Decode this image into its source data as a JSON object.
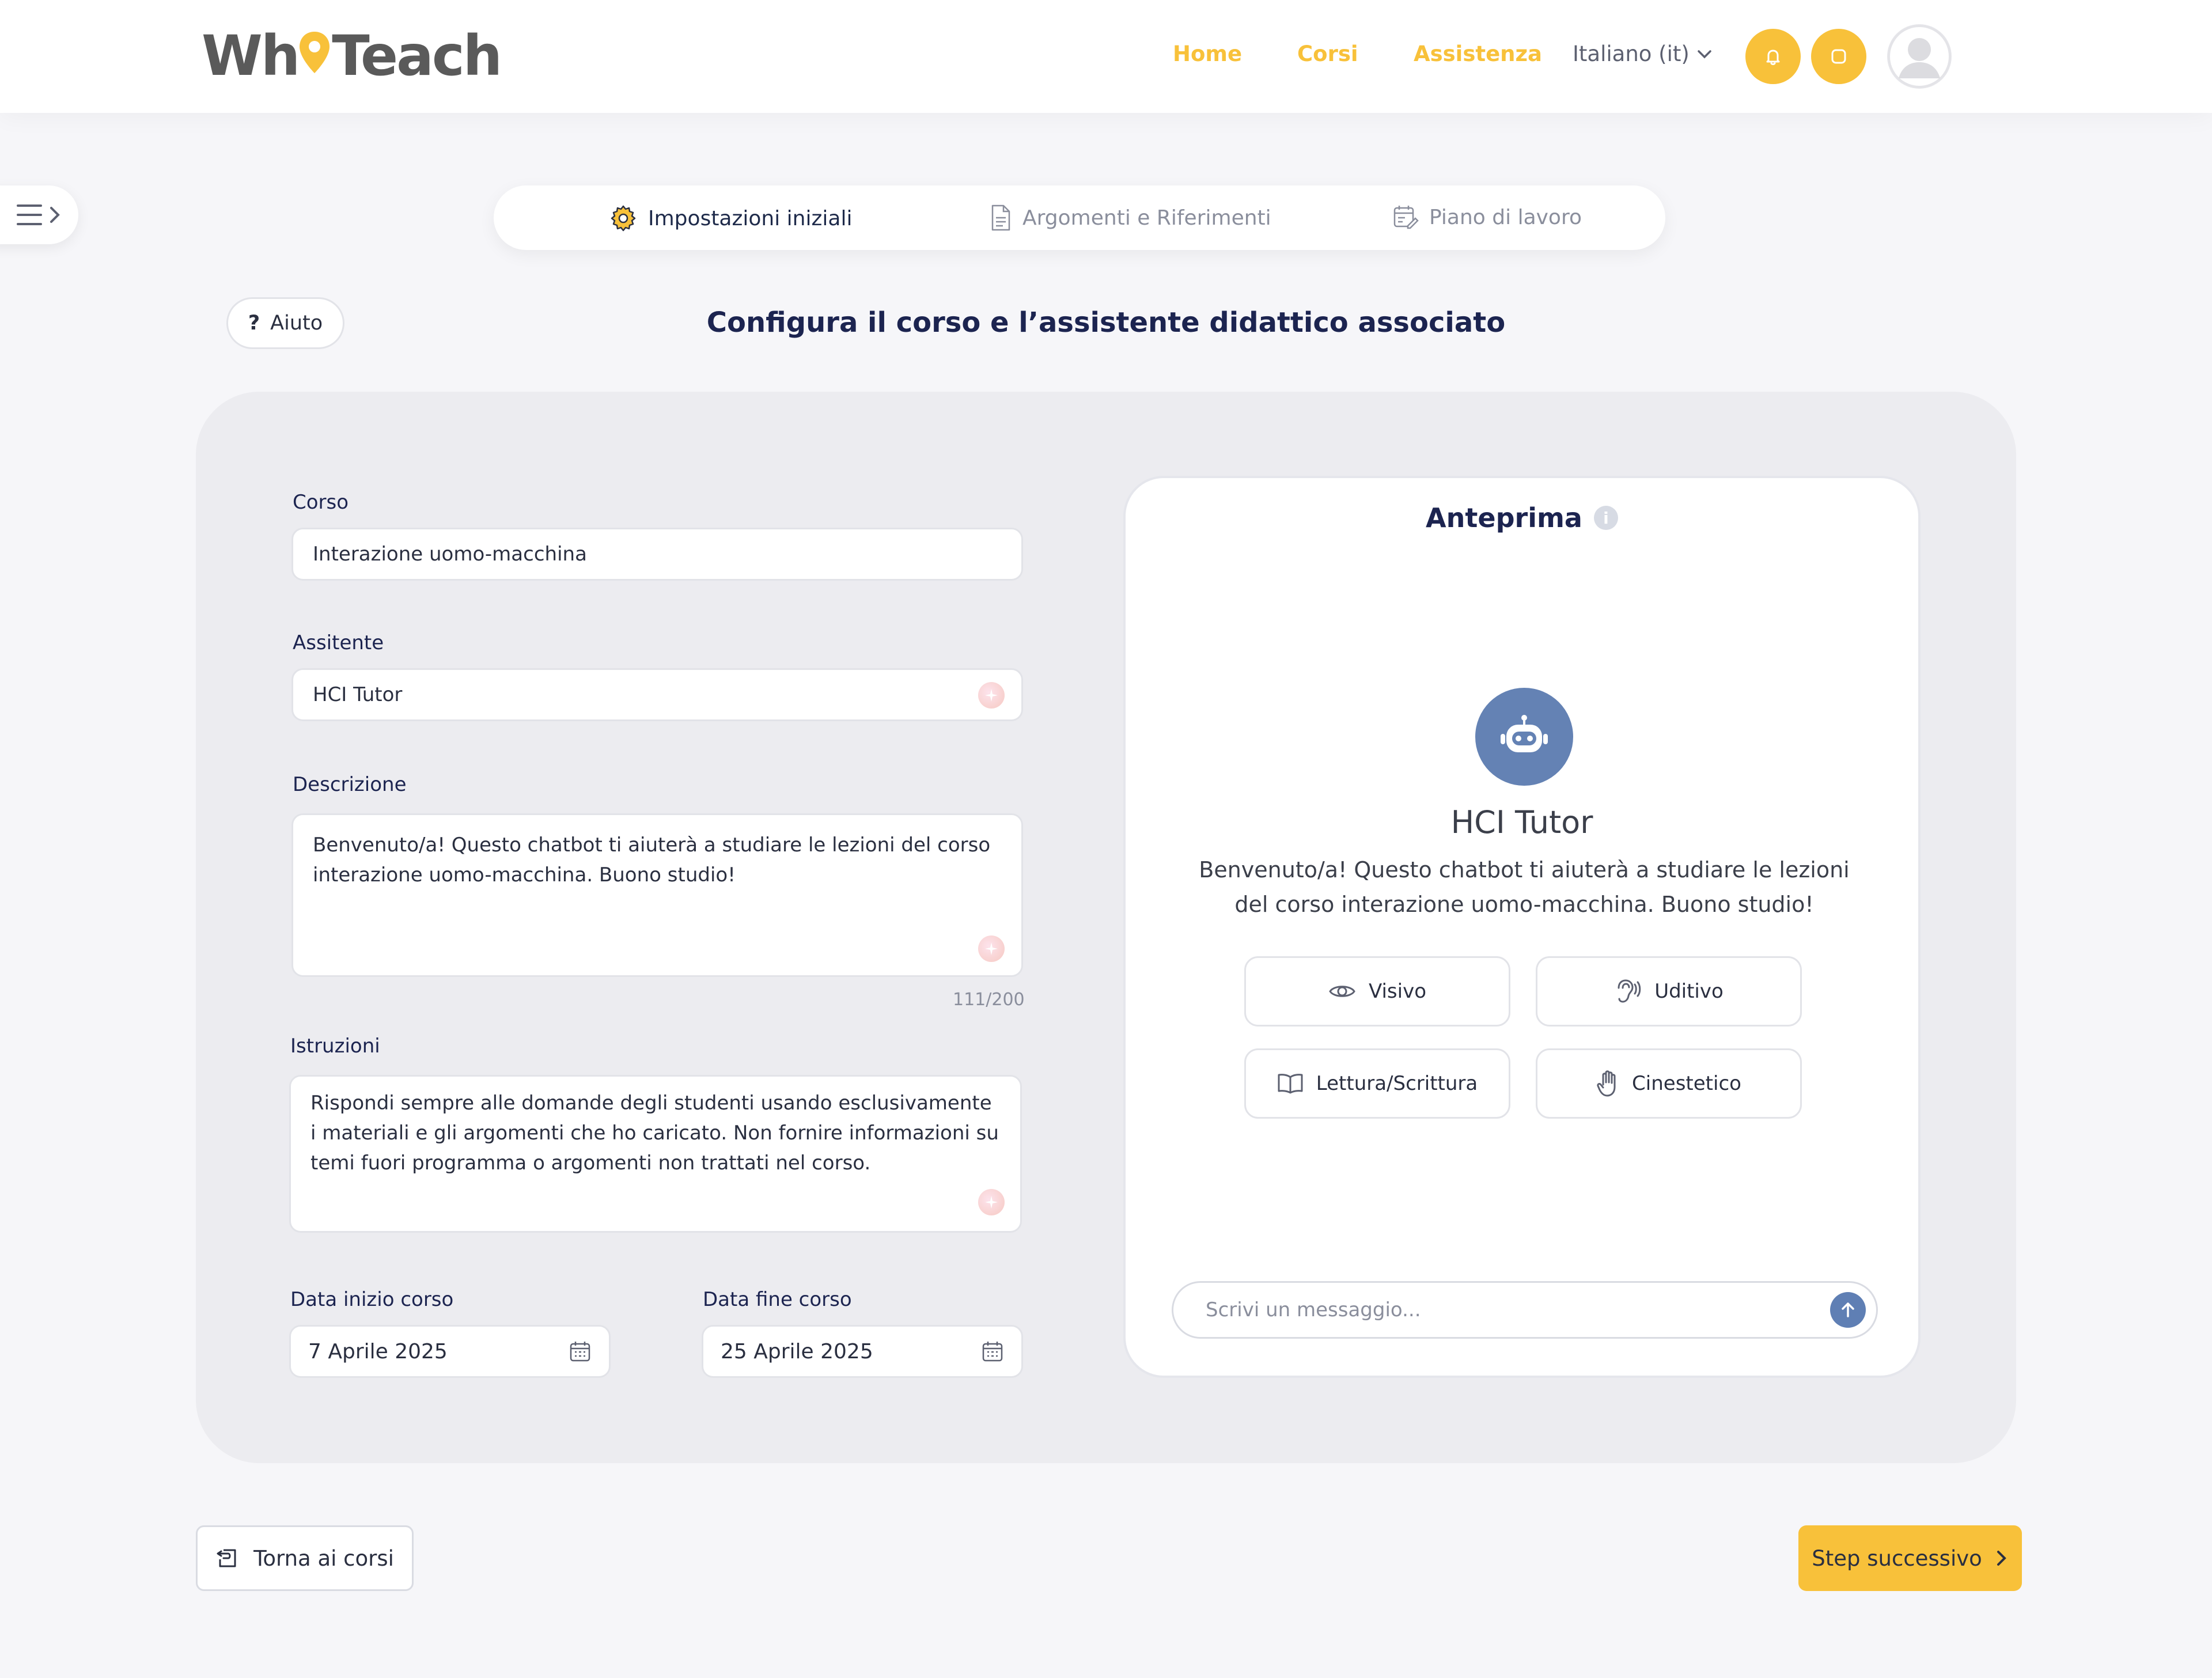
{
  "header": {
    "logo_text_a": "Wh",
    "logo_text_b": "Teach",
    "nav": {
      "home": "Home",
      "courses": "Corsi",
      "support": "Assistenza"
    },
    "language": "Italiano (it)"
  },
  "steps": {
    "step1": "Impostazioni iniziali",
    "step2": "Argomenti e Riferimenti",
    "step3": "Piano di lavoro"
  },
  "help_label": "Aiuto",
  "help_icon": "?",
  "page_title": "Configura il corso e l’assistente didattico associato",
  "form": {
    "course_label": "Corso",
    "course_value": "Interazione uomo-macchina",
    "assistant_label": "Assitente",
    "assistant_value": "HCI Tutor",
    "description_label": "Descrizione",
    "description_value": "Benvenuto/a! Questo chatbot ti aiuterà a studiare le lezioni del corso interazione uomo-macchina. Buono studio!",
    "description_counter": "111/200",
    "instructions_label": "Istruzioni",
    "instructions_value": "Rispondi sempre alle domande degli studenti usando esclusivamente i materiali e gli argomenti che ho caricato. Non fornire informazioni su temi fuori programma o argomenti non trattati nel corso.",
    "start_label": "Data inizio corso",
    "start_value": "7 Aprile 2025",
    "end_label": "Data fine corso",
    "end_value": "25 Aprile 2025"
  },
  "preview": {
    "title": "Anteprima",
    "info_icon": "i",
    "bot_name": "HCI Tutor",
    "bot_description": "Benvenuto/a! Questo chatbot ti aiuterà a studiare le lezioni del corso interazione uomo-macchina. Buono studio!",
    "styles": {
      "visual": "Visivo",
      "auditory": "Uditivo",
      "reading": "Lettura/Scrittura",
      "kinesthetic": "Cinestetico"
    },
    "message_placeholder": "Scrivi un messaggio..."
  },
  "footer": {
    "back_label": "Torna ai corsi",
    "next_label": "Step successivo"
  },
  "colors": {
    "accent": "#f8c13a",
    "navy": "#1c2450",
    "bot": "#6482b4"
  }
}
